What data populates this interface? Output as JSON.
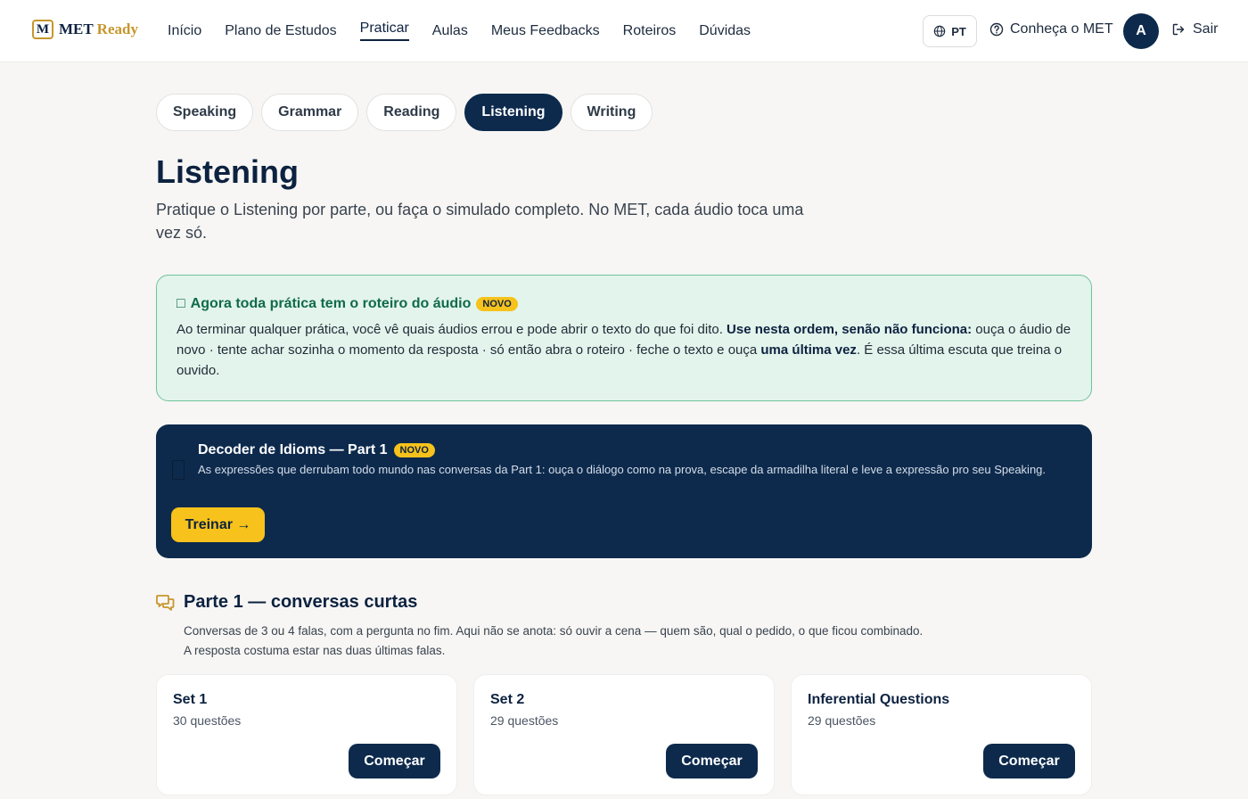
{
  "navbar": {
    "logo_letter": "M",
    "logo_name": "MET",
    "logo_suffix": "Ready",
    "links": [
      "Início",
      "Plano de Estudos",
      "Praticar",
      "Aulas",
      "Meus Feedbacks",
      "Roteiros",
      "Dúvidas"
    ],
    "active_link": "Praticar",
    "language": "PT",
    "know_label": "Conheça o MET",
    "avatar_initial": "A",
    "logout_label": "Sair"
  },
  "tabs": [
    "Speaking",
    "Grammar",
    "Reading",
    "Listening",
    "Writing"
  ],
  "active_tab": "Listening",
  "page": {
    "title": "Listening",
    "description": "Pratique o Listening por parte, ou faça o simulado completo. No MET, cada áudio toca uma vez só."
  },
  "notice": {
    "icon": "□",
    "title": "Agora toda prática tem o roteiro do áudio",
    "badge": "NOVO",
    "text_1": "Ao terminar qualquer prática, você vê quais áudios errou e pode abrir o texto do que foi dito. ",
    "bold_1": "Use nesta ordem, senão não funciona:",
    "text_2": " ouça o áudio de novo · tente achar sozinha o momento da resposta · só então abra o roteiro · feche o texto e ouça ",
    "bold_2": "uma última vez",
    "text_3": ". É essa última escuta que treina o ouvido."
  },
  "decoder": {
    "title": "Decoder de Idioms — Part 1",
    "badge": "NOVO",
    "description": "As expressões que derrubam todo mundo nas conversas da Part 1: ouça o diálogo como na prova, escape da armadilha literal e leve a expressão pro seu Speaking.",
    "button": "Treinar →"
  },
  "section": {
    "title": "Parte 1 — conversas curtas",
    "description_1": "Conversas de 3 ou 4 falas, com a pergunta no fim. Aqui não se anota: só ouvir a cena — quem são, qual o pedido, o que ficou combinado.",
    "description_2": "A resposta costuma estar nas duas últimas falas."
  },
  "cards": [
    {
      "title": "Set 1",
      "count": "30 questões",
      "button": "Começar"
    },
    {
      "title": "Set 2",
      "count": "29 questões",
      "button": "Começar"
    },
    {
      "title": "Inferential Questions",
      "count": "29 questões",
      "button": "Começar"
    }
  ],
  "colors": {
    "navy": "#0d2a4d",
    "gold": "#f6c21b",
    "notice_bg": "#e3f4ec",
    "notice_border": "#6fc49b",
    "section_icon": "#c7962e"
  }
}
